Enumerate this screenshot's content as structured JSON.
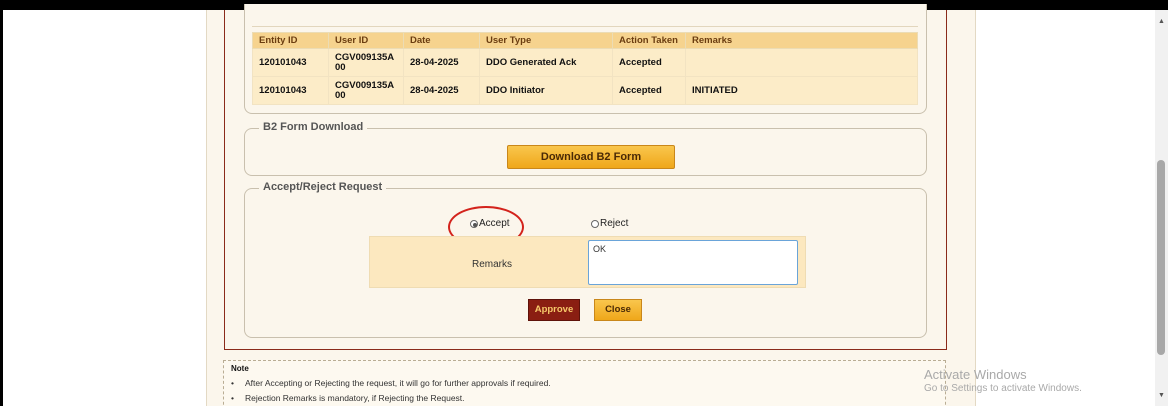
{
  "history_table": {
    "headers": [
      "Entity ID",
      "User ID",
      "Date",
      "User Type",
      "Action Taken",
      "Remarks"
    ],
    "rows": [
      [
        "120101043",
        "CGV009135A\n00",
        "28-04-2025",
        "DDO Generated Ack",
        "Accepted",
        ""
      ],
      [
        "120101043",
        "CGV009135A\n00",
        "28-04-2025",
        "DDO Initiator",
        "Accepted",
        "INITIATED"
      ]
    ]
  },
  "b2_section": {
    "legend": "B2 Form Download",
    "download_label": "Download B2 Form"
  },
  "accept_reject_section": {
    "legend": "Accept/Reject Request",
    "accept_label": "Accept",
    "reject_label": "Reject",
    "selected": "Accept",
    "remarks_label": "Remarks",
    "remarks_value": "OK",
    "approve_label": "Approve",
    "close_label": "Close"
  },
  "note": {
    "title": "Note",
    "items": [
      "After Accepting or Rejecting the request, it will go for further approvals if required.",
      "Rejection Remarks is mandatory, if Rejecting the Request."
    ]
  },
  "watermark": {
    "line1": "Activate Windows",
    "line2": "Go to Settings to activate Windows."
  },
  "icons": {
    "scroll_up": "scroll-up-arrow-icon",
    "scroll_down": "scroll-down-arrow-icon"
  },
  "colors": {
    "header_bg": "#f6d38e",
    "approve_bg": "#8a1e12",
    "highlight_circle": "#d3231c"
  }
}
